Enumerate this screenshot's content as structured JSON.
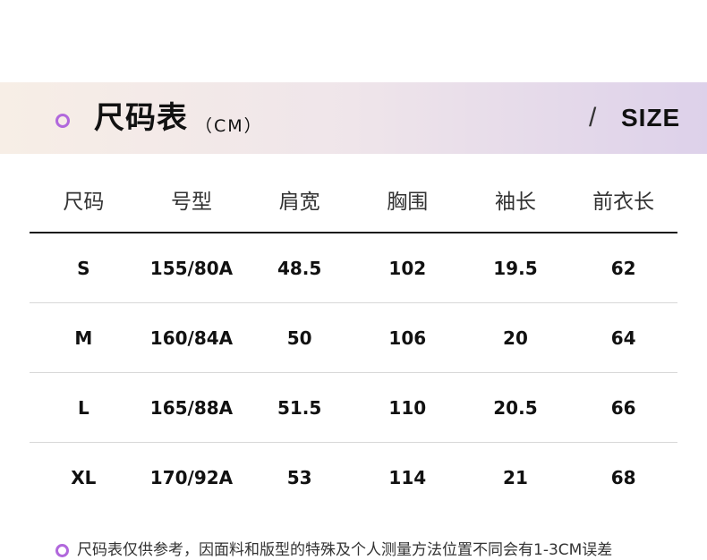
{
  "banner": {
    "title": "尺码表",
    "unit": "（CM）",
    "slash": "/",
    "size_label": "SIZE"
  },
  "table": {
    "headers": [
      "尺码",
      "号型",
      "肩宽",
      "胸围",
      "袖长",
      "前衣长"
    ],
    "rows": [
      [
        "S",
        "155/80A",
        "48.5",
        "102",
        "19.5",
        "62"
      ],
      [
        "M",
        "160/84A",
        "50",
        "106",
        "20",
        "64"
      ],
      [
        "L",
        "165/88A",
        "51.5",
        "110",
        "20.5",
        "66"
      ],
      [
        "XL",
        "170/92A",
        "53",
        "114",
        "21",
        "68"
      ]
    ]
  },
  "note": {
    "text": "尺码表仅供参考，因面料和版型的特殊及个人测量方法位置不同会有1-3CM误差"
  },
  "colors": {
    "accent": "#b168dc",
    "banner_start": "#f7eee6",
    "banner_end": "#ddd1ea"
  }
}
